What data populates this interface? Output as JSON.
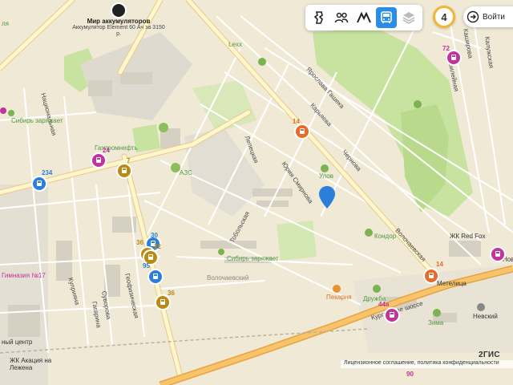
{
  "colors": {
    "background": "#efe9d6",
    "road_main": "#fff6cc",
    "road_highway": "#f7c36b",
    "road_highway_stroke": "#e8a33d",
    "park": "#c8e3a0",
    "bus_stop_pink": "#c2339c",
    "bus_stop_blue": "#2b7fd9",
    "bus_stop_orange": "#e96b2a",
    "bus_stop_gold": "#b98a16",
    "toolbar_active": "#2b8ee6",
    "pin": "#2b7fd9"
  },
  "toolbar": {
    "buttons": [
      {
        "name": "traffic-button",
        "icon": "traffic-light-icon",
        "active": false
      },
      {
        "name": "people-button",
        "icon": "people-icon",
        "active": false
      },
      {
        "name": "mountain-button",
        "icon": "mountain-icon",
        "active": false
      },
      {
        "name": "transport-button",
        "icon": "bus-icon",
        "active": true
      },
      {
        "name": "layers-button",
        "icon": "layers-icon",
        "active": false
      }
    ],
    "counter": "4",
    "login_label": "Войти"
  },
  "ad": {
    "title": "Мир аккумуляторов",
    "description": "Аккумулятор Element 60 Ач за 3150 р."
  },
  "brand": "2ГИС",
  "license": "Лицензионное соглашение, политика конфиденциальности",
  "street_labels": {
    "natsionalnaya": "Национальная",
    "kupriyanova": "Куприяна",
    "gagarina": "Гагарина",
    "suvorova": "Суворова",
    "geofizicheskaya": "Геофизическая",
    "lepeshkina": "Лепецкая",
    "tobolskaya": "Тобольская",
    "yuriya_smirnova": "Юрия Смирнова",
    "karyaeva": "Карьяева",
    "yaroslava_gasheka": "Ярослава Гашека",
    "chernovaya": "Чернова",
    "volochaevskaya": "Волочаевская",
    "yubileynaya": "Юбилейная",
    "kashirova": "Каширова",
    "kaluzhskaya": "Калужская",
    "kurgan_shosse": "Курганское шоссе",
    "volochaevskaya_area": "Волочаевский"
  },
  "poi_labels": {
    "lexx": "Lexx",
    "sibir_1": "Сибирь заряжает",
    "sibir_2": "Сибирь заряжает",
    "gazpromneft": "Газпромнефть",
    "azs": "АЗС",
    "ulov": "Улов",
    "kondor": "Кондор",
    "red_fox": "ЖК Red Fox",
    "metelitsa": "Метелица",
    "pekarnya": "Пекарня",
    "druzhba": "Дружба",
    "zima": "Зима",
    "nevskiy": "Невский",
    "nova": "Нова",
    "akatsiya": "ЖК Акация на Лежена",
    "gimnaziya": "Гимназия №17",
    "tsentr": "ный центр",
    "lenina": "ля"
  },
  "stops": [
    {
      "name": "stop-72",
      "route": "72",
      "type": "pink"
    },
    {
      "name": "stop-14-top",
      "route": "14",
      "type": "orange"
    },
    {
      "name": "stop-24",
      "route": "24",
      "type": "pink"
    },
    {
      "name": "stop-7",
      "route": "7",
      "type": "gold"
    },
    {
      "name": "stop-234",
      "route": "234",
      "type": "blue"
    },
    {
      "name": "stop-30",
      "route": "30",
      "type": "blue"
    },
    {
      "name": "stop-36-a",
      "route": "36",
      "type": "gold"
    },
    {
      "name": "stop-22",
      "route": "22",
      "type": "gold"
    },
    {
      "name": "stop-95",
      "route": "95",
      "type": "blue"
    },
    {
      "name": "stop-36-b",
      "route": "36",
      "type": "gold"
    },
    {
      "name": "stop-14-bottom",
      "route": "14",
      "type": "orange"
    },
    {
      "name": "stop-44a",
      "route": "44a",
      "type": "pink"
    },
    {
      "name": "stop-90",
      "route": "90",
      "type": "pink"
    },
    {
      "name": "stop-right",
      "route": "",
      "type": "pink"
    },
    {
      "name": "stop-left",
      "route": "",
      "type": "pink"
    }
  ]
}
